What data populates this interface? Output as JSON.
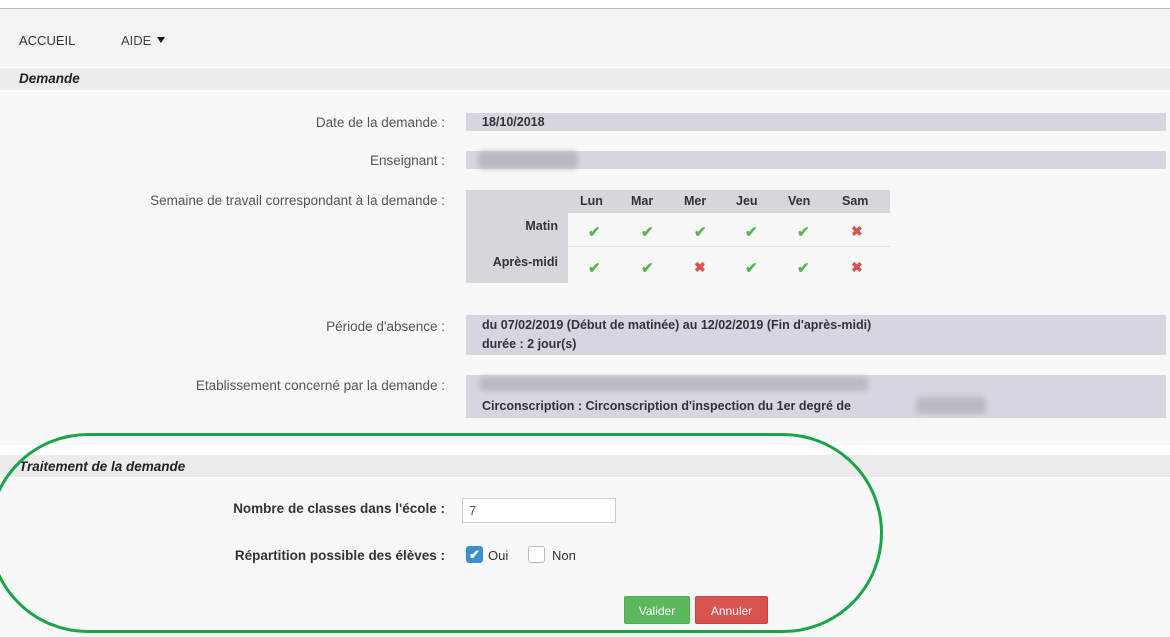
{
  "nav": {
    "accueil": "ACCUEIL",
    "aide": "AIDE"
  },
  "demande": {
    "title": "Demande",
    "date_label": "Date de la demande :",
    "date_value": "18/10/2018",
    "enseignant_label": "Enseignant :",
    "semaine_label": "Semaine de travail correspondant à la demande :",
    "days": [
      "Lun",
      "Mar",
      "Mer",
      "Jeu",
      "Ven",
      "Sam"
    ],
    "rows": [
      {
        "label": "Matin",
        "marks": [
          "check",
          "check",
          "check",
          "check",
          "check",
          "cross"
        ]
      },
      {
        "label": "Après-midi",
        "marks": [
          "check",
          "check",
          "cross",
          "check",
          "check",
          "cross"
        ]
      }
    ],
    "check_glyph": "✔",
    "cross_glyph": "✖",
    "periode_label": "Période d'absence :",
    "periode_line1": "du 07/02/2019 (Début de matinée) au 12/02/2019 (Fin d'après-midi)",
    "periode_line2": "durée : 2 jour(s)",
    "etab_label": "Etablissement concerné par la demande :",
    "circonscription": "Circonscription : Circonscription d'inspection du 1er degré de"
  },
  "traitement": {
    "title": "Traitement de la demande",
    "nb_classes_label": "Nombre de classes dans l'école :",
    "nb_classes_value": "7",
    "repartition_label": "Répartition possible des élèves :",
    "oui": "Oui",
    "non": "Non",
    "oui_checked": true,
    "valider": "Valider",
    "annuler": "Annuler"
  },
  "colors": {
    "check": "#5ab552",
    "cross": "#d9534f",
    "valider": "#5cb85c",
    "annuler": "#d9534f",
    "highlight": "#18a548"
  }
}
